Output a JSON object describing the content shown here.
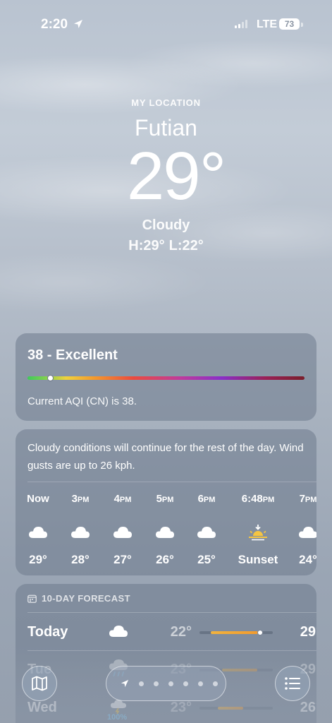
{
  "status_bar": {
    "time": "2:20",
    "network": "LTE",
    "battery": "73"
  },
  "header": {
    "label": "MY LOCATION",
    "city": "Futian",
    "temperature": "29°",
    "condition": "Cloudy",
    "high": "H:29°",
    "low": "L:22°"
  },
  "aqi": {
    "title": "38 - Excellent",
    "description": "Current AQI (CN) is 38.",
    "value": 38
  },
  "hourly": {
    "summary": "Cloudy conditions will continue for the rest of the day. Wind gusts are up to 26 kph.",
    "hours": [
      {
        "time": "Now",
        "ampm": "",
        "icon": "cloud-icon",
        "temp": "29°"
      },
      {
        "time": "3",
        "ampm": "PM",
        "icon": "cloud-icon",
        "temp": "28°"
      },
      {
        "time": "4",
        "ampm": "PM",
        "icon": "cloud-icon",
        "temp": "27°"
      },
      {
        "time": "5",
        "ampm": "PM",
        "icon": "cloud-icon",
        "temp": "26°"
      },
      {
        "time": "6",
        "ampm": "PM",
        "icon": "cloud-icon",
        "temp": "25°"
      },
      {
        "time": "6:48",
        "ampm": "PM",
        "icon": "sunset-icon",
        "temp": "Sunset"
      },
      {
        "time": "7",
        "ampm": "PM",
        "icon": "cloud-icon",
        "temp": "24°"
      }
    ]
  },
  "ten_day": {
    "title": "10-DAY FORECAST",
    "days": [
      {
        "day": "Today",
        "icon": "cloud-icon",
        "low": "22°",
        "high": "29°",
        "precip": ""
      },
      {
        "day": "Tue",
        "icon": "cloud-rain-icon",
        "low": "23°",
        "high": "29°",
        "precip": ""
      },
      {
        "day": "Wed",
        "icon": "thunderstorm-icon",
        "low": "23°",
        "high": "26°",
        "precip": "100%"
      }
    ]
  },
  "bottom_bar": {
    "pages": 7,
    "current_page": 0
  },
  "colors": {
    "card_bg": "#6e7a8c",
    "temp_bar": "#f39a2c",
    "precip": "#7fd3ff"
  }
}
